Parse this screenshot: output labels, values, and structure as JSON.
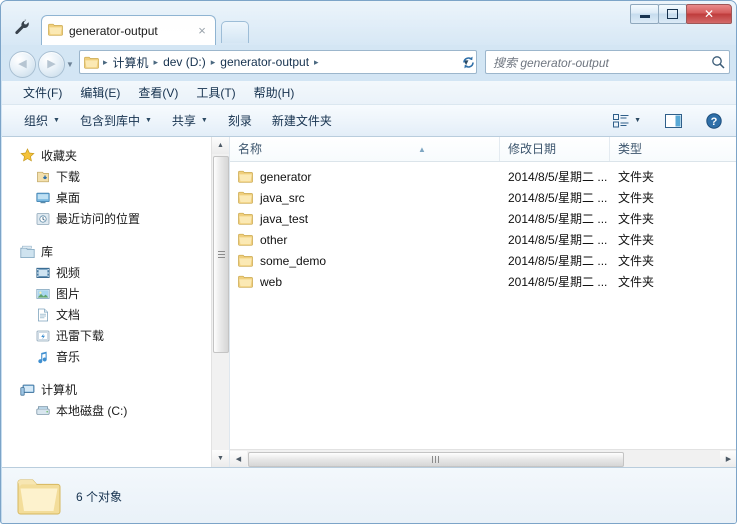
{
  "window": {
    "titlebar": {
      "settings_icon": "wrench-icon",
      "tab_label": "generator-output",
      "tab_close_glyph": "×",
      "new_tab_tooltip": "new-tab"
    },
    "controls": {
      "minimize": "minimize",
      "maximize": "maximize",
      "close": "✕",
      "close_color": "#c0392b"
    }
  },
  "addressbar": {
    "back_glyph": "◀",
    "forward_glyph": "▶",
    "history_caret": "▼",
    "breadcrumbs": [
      "计算机",
      "dev (D:)",
      "generator-output"
    ],
    "separator": "▸",
    "dropdown_caret": "▼",
    "refresh_icon": "refresh-icon",
    "search": {
      "placeholder": "搜索 generator-output",
      "value": "",
      "icon": "search-icon"
    }
  },
  "menubar": {
    "items": [
      {
        "label": "文件(F)"
      },
      {
        "label": "编辑(E)"
      },
      {
        "label": "查看(V)"
      },
      {
        "label": "工具(T)"
      },
      {
        "label": "帮助(H)"
      }
    ]
  },
  "toolbar": {
    "buttons": [
      {
        "label": "组织",
        "caret": true
      },
      {
        "label": "包含到库中",
        "caret": true
      },
      {
        "label": "共享",
        "caret": true
      },
      {
        "label": "刻录",
        "caret": false
      },
      {
        "label": "新建文件夹",
        "caret": false
      }
    ],
    "right_icons": [
      {
        "name": "view-mode-icon",
        "caret": true
      },
      {
        "name": "preview-pane-icon",
        "caret": false
      },
      {
        "name": "help-icon",
        "caret": false
      }
    ],
    "caret_glyph": "▼"
  },
  "sidebar": {
    "groups": [
      {
        "header": {
          "label": "收藏夹",
          "icon": "star-icon"
        },
        "items": [
          {
            "label": "下载",
            "icon": "downloads-icon"
          },
          {
            "label": "桌面",
            "icon": "desktop-icon"
          },
          {
            "label": "最近访问的位置",
            "icon": "recent-places-icon"
          }
        ]
      },
      {
        "header": {
          "label": "库",
          "icon": "library-icon"
        },
        "items": [
          {
            "label": "视频",
            "icon": "video-icon"
          },
          {
            "label": "图片",
            "icon": "pictures-icon"
          },
          {
            "label": "文档",
            "icon": "documents-icon"
          },
          {
            "label": "迅雷下载",
            "icon": "thunder-download-icon"
          },
          {
            "label": "音乐",
            "icon": "music-icon"
          }
        ]
      },
      {
        "header": {
          "label": "计算机",
          "icon": "computer-icon"
        },
        "items": [
          {
            "label": "本地磁盘 (C:)",
            "icon": "drive-icon"
          }
        ]
      }
    ],
    "scrollbar": {
      "up": "▲",
      "down": "▼"
    }
  },
  "filelist": {
    "columns": [
      {
        "key": "name",
        "label": "名称",
        "sorted": "asc",
        "sort_glyph": "▲"
      },
      {
        "key": "date",
        "label": "修改日期"
      },
      {
        "key": "type",
        "label": "类型"
      }
    ],
    "rows": [
      {
        "name": "generator",
        "date": "2014/8/5/星期二 ...",
        "type": "文件夹",
        "icon": "folder-icon"
      },
      {
        "name": "java_src",
        "date": "2014/8/5/星期二 ...",
        "type": "文件夹",
        "icon": "folder-icon"
      },
      {
        "name": "java_test",
        "date": "2014/8/5/星期二 ...",
        "type": "文件夹",
        "icon": "folder-icon"
      },
      {
        "name": "other",
        "date": "2014/8/5/星期二 ...",
        "type": "文件夹",
        "icon": "folder-icon"
      },
      {
        "name": "some_demo",
        "date": "2014/8/5/星期二 ...",
        "type": "文件夹",
        "icon": "folder-icon"
      },
      {
        "name": "web",
        "date": "2014/8/5/星期二 ...",
        "type": "文件夹",
        "icon": "folder-icon"
      }
    ],
    "hscroll": {
      "left": "◀",
      "right": "▶"
    }
  },
  "statusbar": {
    "icon": "large-folder-icon",
    "text": "6 个对象"
  },
  "colors": {
    "frame": "#c3dbee",
    "accent": "#16324f",
    "close_red": "#c0392b",
    "folder_yellow": "#f5d47a"
  }
}
